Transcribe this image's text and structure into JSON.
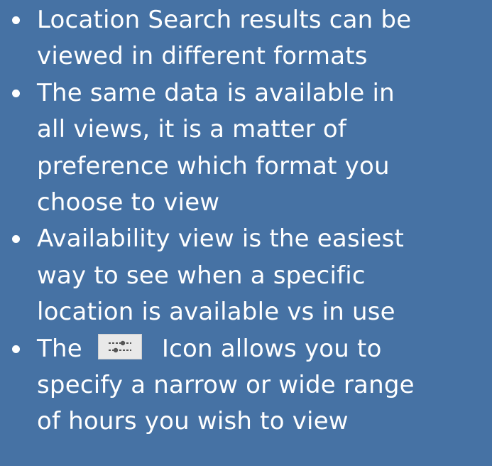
{
  "bullets": [
    {
      "lines": [
        "Location Search results can be",
        "viewed in different formats"
      ]
    },
    {
      "lines": [
        "The same data is available in",
        "all views, it is a matter of",
        "preference which format you",
        "choose to view"
      ]
    },
    {
      "lines": [
        "Availability view is the easiest",
        "way to see when a specific",
        "location is available vs in use"
      ]
    },
    {
      "first_line_before": "The",
      "icon": "filter-sliders-icon",
      "first_line_after": "Icon allows you to",
      "lines": [
        "specify a narrow or wide range",
        "of hours you wish to view"
      ]
    }
  ],
  "colors": {
    "background": "#4672a4",
    "text": "#ffffff"
  }
}
